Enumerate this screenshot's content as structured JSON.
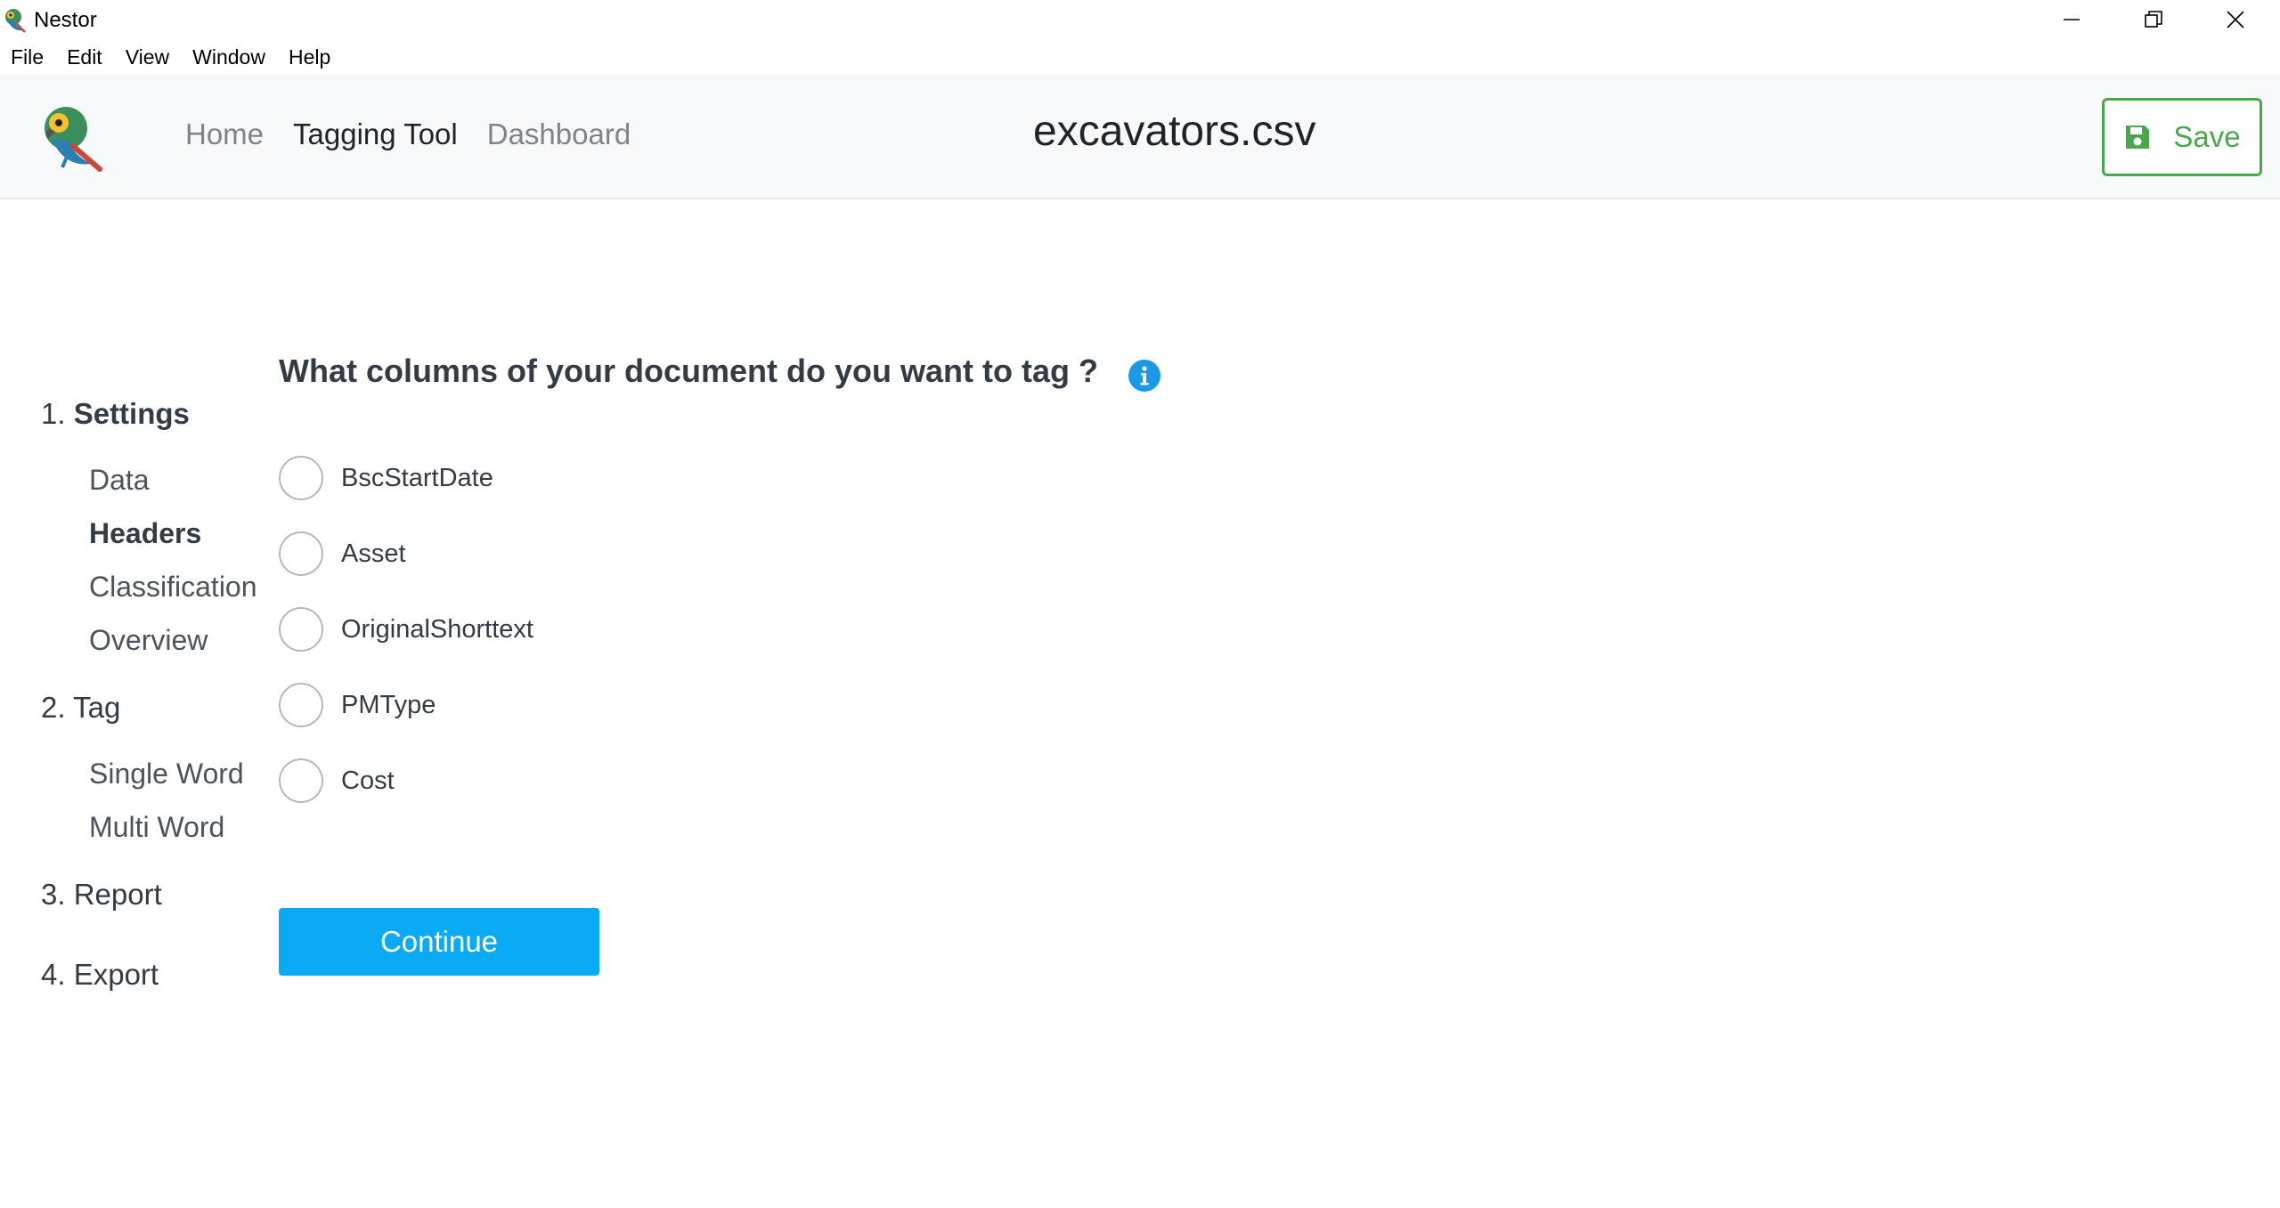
{
  "window": {
    "title": "Nestor",
    "controls": [
      "minimize-icon",
      "restore-icon",
      "close-icon"
    ]
  },
  "menu": [
    "File",
    "Edit",
    "View",
    "Window",
    "Help"
  ],
  "header": {
    "nav": [
      {
        "label": "Home",
        "active": false
      },
      {
        "label": "Tagging Tool",
        "active": true
      },
      {
        "label": "Dashboard",
        "active": false
      }
    ],
    "file_title": "excavators.csv",
    "save_label": "Save",
    "save_icon": "floppy-disk-icon",
    "accent_color": "#4aa84c"
  },
  "sidebar": {
    "steps": [
      {
        "number": "1.",
        "label": "Settings",
        "bold": true,
        "substeps": [
          {
            "label": "Data",
            "active": false
          },
          {
            "label": "Headers",
            "active": true
          },
          {
            "label": "Classification",
            "active": false
          },
          {
            "label": "Overview",
            "active": false
          }
        ]
      },
      {
        "number": "2.",
        "label": "Tag",
        "bold": false,
        "substeps": [
          {
            "label": "Single Word",
            "active": false
          },
          {
            "label": "Multi Word",
            "active": false
          }
        ]
      },
      {
        "number": "3.",
        "label": "Report",
        "bold": false,
        "substeps": []
      },
      {
        "number": "4.",
        "label": "Export",
        "bold": false,
        "substeps": []
      }
    ]
  },
  "main": {
    "question": "What columns of your document do you want to tag ?",
    "info_icon": "info-icon",
    "options": [
      {
        "label": "BscStartDate",
        "checked": false
      },
      {
        "label": "Asset",
        "checked": false
      },
      {
        "label": "OriginalShorttext",
        "checked": false
      },
      {
        "label": "PMType",
        "checked": false
      },
      {
        "label": "Cost",
        "checked": false
      }
    ],
    "continue_label": "Continue",
    "continue_color": "#0aaaf5"
  }
}
